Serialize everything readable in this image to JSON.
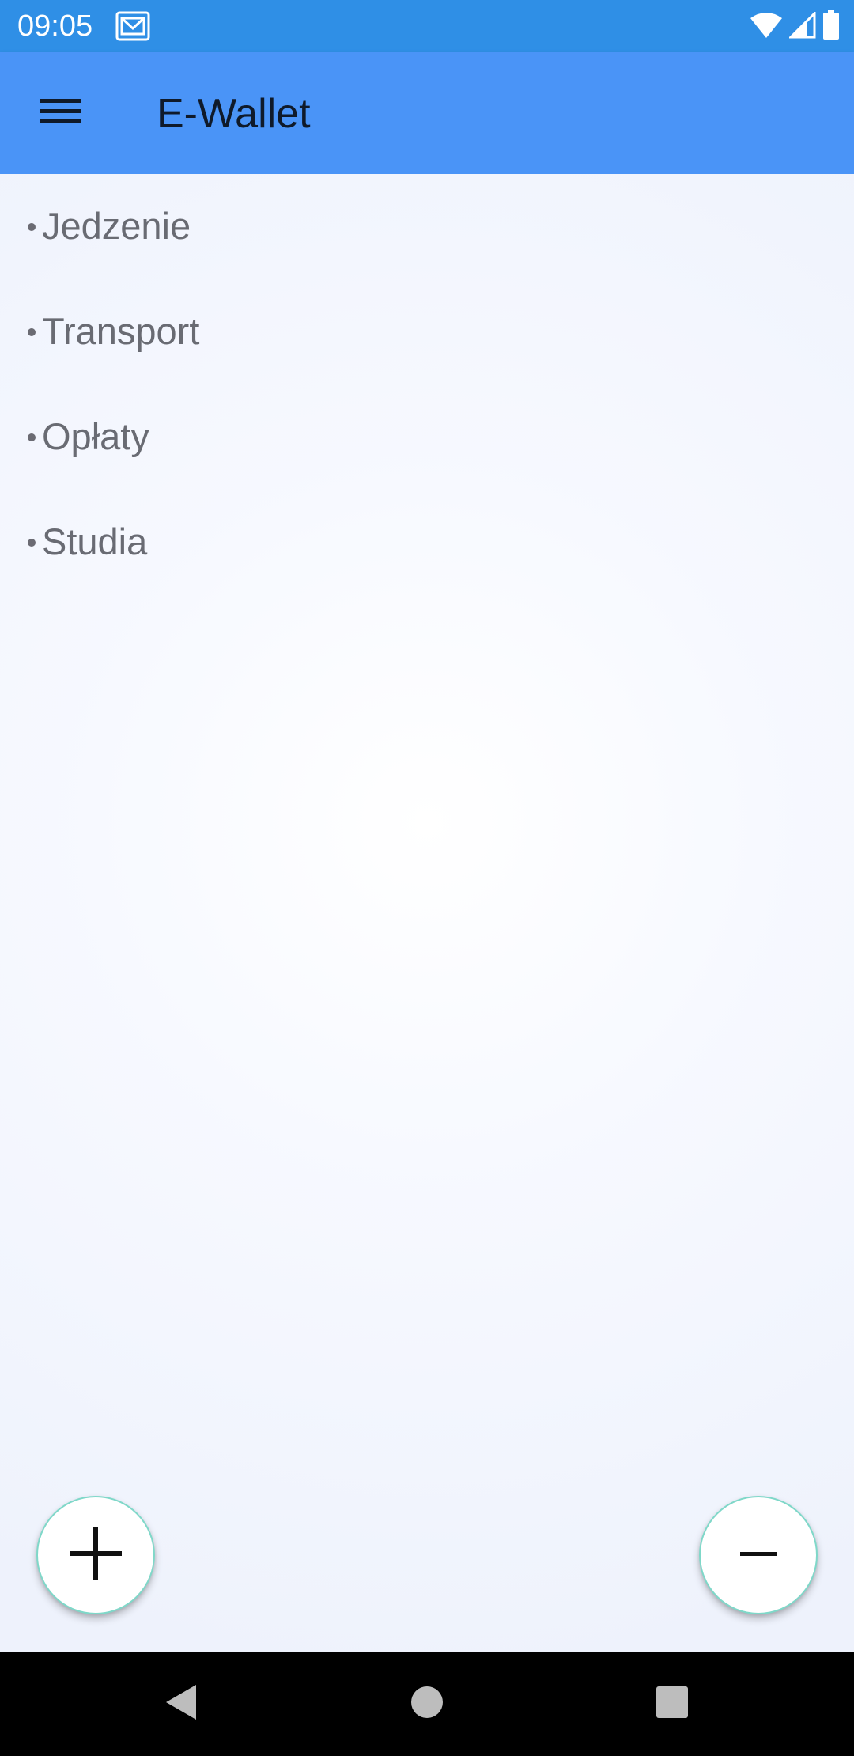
{
  "status_bar": {
    "time": "09:05",
    "icons": [
      "mail-icon",
      "wifi-icon",
      "signal-icon",
      "battery-icon"
    ]
  },
  "app_bar": {
    "title": "E-Wallet",
    "menu_icon": "hamburger-menu-icon",
    "background_color": "#4a94f7"
  },
  "categories": [
    {
      "label": "Jedzenie"
    },
    {
      "label": "Transport"
    },
    {
      "label": "Opłaty"
    },
    {
      "label": "Studia"
    }
  ],
  "fabs": {
    "add_icon": "plus-icon",
    "remove_icon": "minus-icon"
  },
  "nav_bar": {
    "icons": [
      "back-icon",
      "home-icon",
      "recents-icon"
    ]
  },
  "colors": {
    "status_bar": "#2f8fe6",
    "app_bar": "#4a94f7",
    "text": "#696b73",
    "fab_border": "#7fd8c9"
  }
}
